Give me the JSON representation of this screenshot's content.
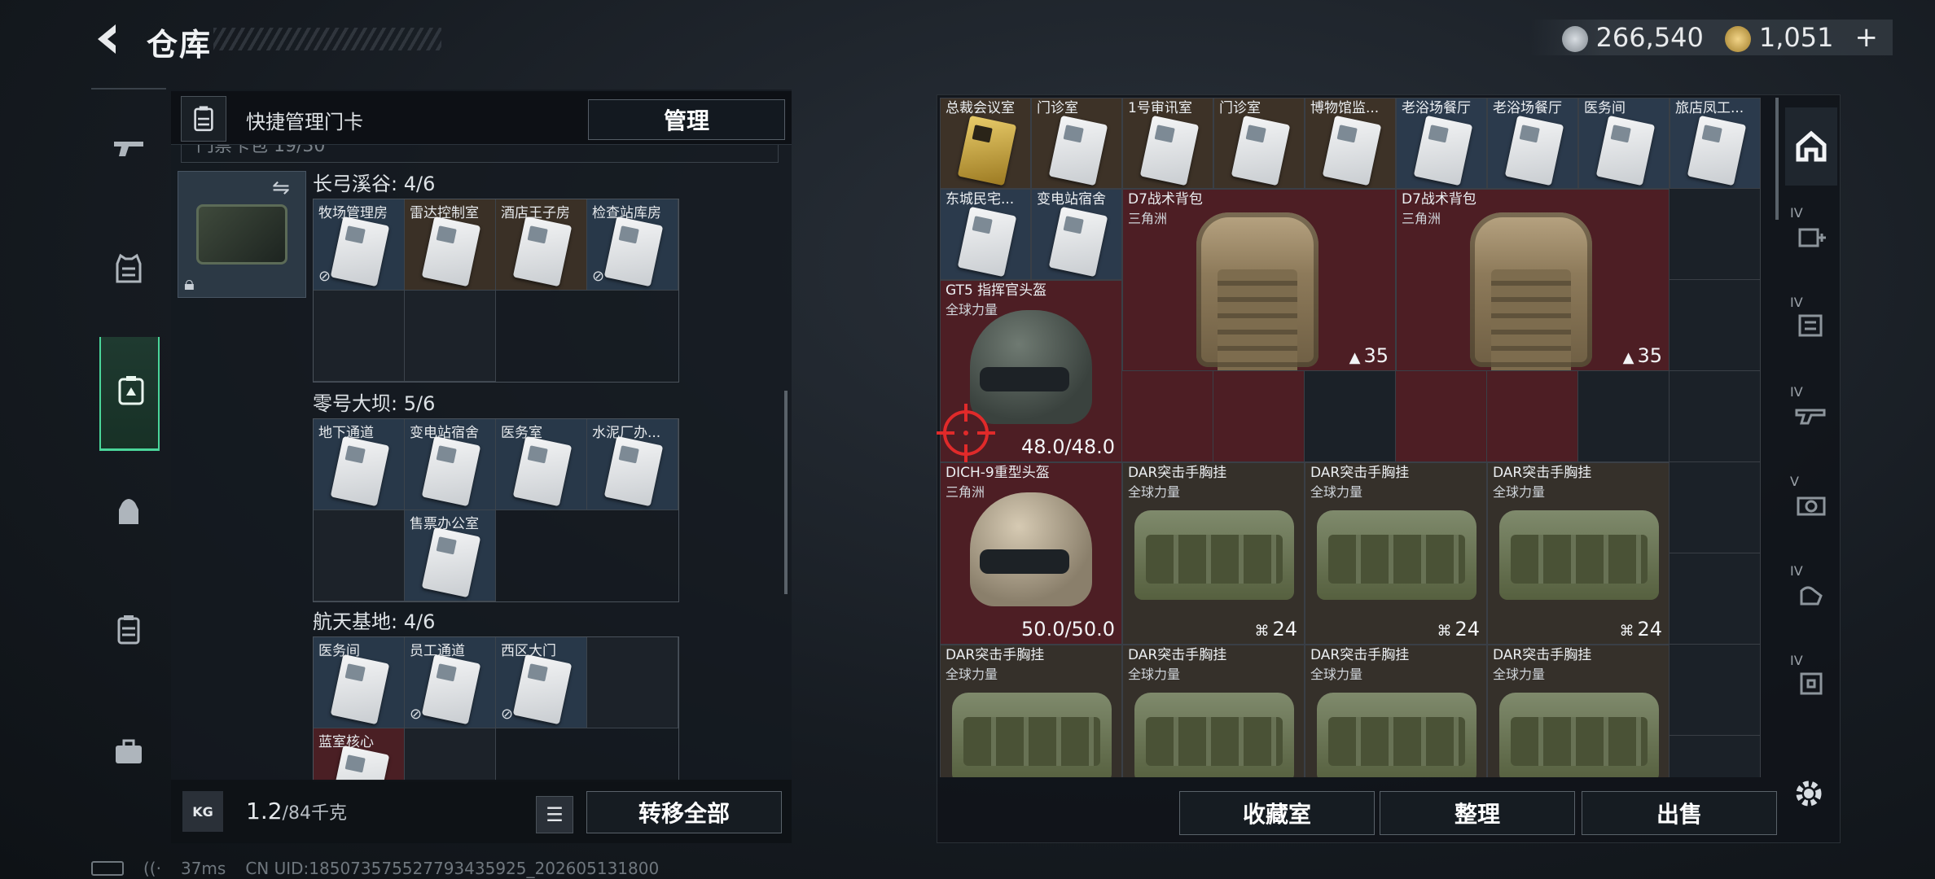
{
  "header": {
    "title": "仓库",
    "silver": "266,540",
    "gold": "1,051",
    "plus": "+"
  },
  "left_panel": {
    "quick_label": "快捷管理门卡",
    "manage_label": "管理",
    "keybag_label": "门禁卡包 19/30",
    "sections": [
      {
        "title": "长弓溪谷: 4/6",
        "cards": [
          {
            "label": "牧场管理房",
            "bg": "card",
            "no_link": true
          },
          {
            "label": "雷达控制室",
            "bg": "brown",
            "no_link": false
          },
          {
            "label": "酒店王子房",
            "bg": "brown",
            "no_link": false
          },
          {
            "label": "检查站库房",
            "bg": "card",
            "no_link": true
          },
          {
            "label": "",
            "bg": "empty"
          },
          {
            "label": "",
            "bg": "empty"
          }
        ]
      },
      {
        "title": "零号大坝: 5/6",
        "cards": [
          {
            "label": "地下通道",
            "bg": "card",
            "no_link": false
          },
          {
            "label": "变电站宿舍",
            "bg": "card",
            "no_link": false
          },
          {
            "label": "医务室",
            "bg": "card",
            "no_link": false
          },
          {
            "label": "水泥厂办...",
            "bg": "card",
            "no_link": false
          },
          {
            "label": "",
            "bg": "empty"
          },
          {
            "label": "售票办公室",
            "bg": "card",
            "no_link": false
          }
        ]
      },
      {
        "title": "航天基地: 4/6",
        "cards": [
          {
            "label": "医务间",
            "bg": "card",
            "no_link": false
          },
          {
            "label": "员工通道",
            "bg": "card",
            "no_link": true
          },
          {
            "label": "西区大门",
            "bg": "card",
            "no_link": true
          },
          {
            "label": "",
            "bg": "empty"
          },
          {
            "label": "蓝室核心",
            "bg": "red",
            "no_link": false
          },
          {
            "label": "",
            "bg": "empty"
          }
        ]
      }
    ],
    "weight_value": "1.2",
    "weight_max": "/84千克",
    "kg_label": "KG",
    "transfer_label": "转移全部"
  },
  "stash": {
    "keycards_row": [
      {
        "label": "总裁会议室",
        "bg": "brown",
        "gold": true
      },
      {
        "label": "门诊室",
        "bg": "brown"
      },
      {
        "label": "1号审讯室",
        "bg": "brown"
      },
      {
        "label": "门诊室",
        "bg": "brown"
      },
      {
        "label": "博物馆监...",
        "bg": "brown"
      },
      {
        "label": "老浴场餐厅",
        "bg": "card"
      },
      {
        "label": "老浴场餐厅",
        "bg": "card"
      },
      {
        "label": "医务间",
        "bg": "card"
      },
      {
        "label": "旅店凤工...",
        "bg": "card"
      }
    ],
    "keycards_row2": [
      {
        "label": "东城民宅...",
        "bg": "card"
      },
      {
        "label": "变电站宿舍",
        "bg": "card"
      }
    ],
    "backpacks": [
      {
        "name": "D7战术背包",
        "sub": "三角洲",
        "count": "35"
      },
      {
        "name": "D7战术背包",
        "sub": "三角洲",
        "count": "35"
      }
    ],
    "helmets": [
      {
        "name": "GT5 指挥官头盔",
        "sub": "全球力量",
        "durability": "48.0/48.0"
      },
      {
        "name": "DICH-9重型头盔",
        "sub": "三角洲",
        "durability": "50.0/50.0"
      }
    ],
    "vests": [
      {
        "name": "DAR突击手胸挂",
        "sub": "全球力量",
        "count": "24"
      },
      {
        "name": "DAR突击手胸挂",
        "sub": "全球力量",
        "count": "24"
      },
      {
        "name": "DAR突击手胸挂",
        "sub": "全球力量",
        "count": "24"
      },
      {
        "name": "DAR突击手胸挂",
        "sub": "全球力量",
        "count": ""
      },
      {
        "name": "DAR突击手胸挂",
        "sub": "全球力量",
        "count": ""
      },
      {
        "name": "DAR突击手胸挂",
        "sub": "全球力量",
        "count": ""
      },
      {
        "name": "DAR突击手胸挂",
        "sub": "全球力量",
        "count": ""
      }
    ],
    "buttons": {
      "collection": "收藏室",
      "sort": "整理",
      "sell": "出售"
    }
  },
  "right_tabs": [
    {
      "level": ""
    },
    {
      "level": "IV"
    },
    {
      "level": "IV"
    },
    {
      "level": "IV"
    },
    {
      "level": "V"
    },
    {
      "level": "IV"
    },
    {
      "level": "IV"
    }
  ],
  "status_bar": {
    "ping": "37ms",
    "uid": "CN UID:18507357552779343592​5_202605131800"
  },
  "colors": {
    "accent_green": "#4ad69a",
    "crosshair_red": "#e02a2a",
    "card_blue": "#283849",
    "brown": "#3a3026",
    "red": "#4a1f24"
  }
}
